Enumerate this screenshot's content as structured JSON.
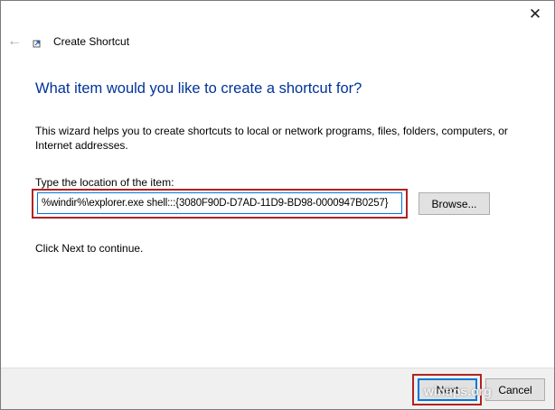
{
  "window": {
    "title": "Create Shortcut",
    "close_glyph": "✕",
    "back_glyph": "←"
  },
  "main": {
    "heading": "What item would you like to create a shortcut for?",
    "description": "This wizard helps you to create shortcuts to local or network programs, files, folders, computers, or Internet addresses.",
    "location_label": "Type the location of the item:",
    "location_value": "%windir%\\explorer.exe shell:::{3080F90D-D7AD-11D9-BD98-0000947B0257}",
    "browse_label": "Browse...",
    "hint": "Click Next to continue."
  },
  "footer": {
    "next_label": "Next",
    "cancel_label": "Cancel",
    "watermark": "wintips.org"
  },
  "colors": {
    "heading": "#003399",
    "focus_border": "#0078d7",
    "highlight": "#b22222",
    "footer_bg": "#f0f0f0",
    "button_bg": "#e1e1e1"
  },
  "icons": {
    "back": "back-arrow-icon",
    "close": "close-icon",
    "app": "shortcut-icon"
  }
}
